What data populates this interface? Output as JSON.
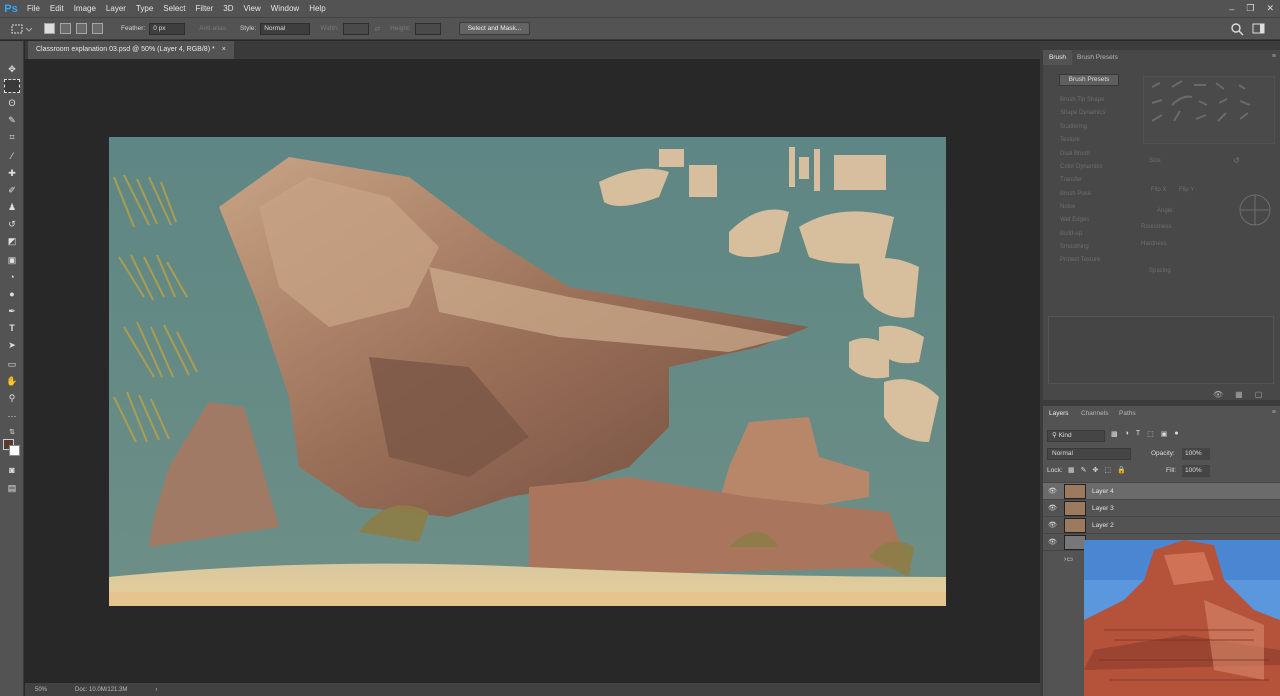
{
  "app": {
    "logo": "Ps",
    "accent": "#31a8ff"
  },
  "menu": [
    "File",
    "Edit",
    "Image",
    "Layer",
    "Type",
    "Select",
    "Filter",
    "3D",
    "View",
    "Window",
    "Help"
  ],
  "window_controls": {
    "minimize": "–",
    "restore": "❐",
    "close": "✕"
  },
  "options_bar": {
    "feather_label": "Feather:",
    "feather_value": "0 px",
    "anti_alias_label": "Anti-alias",
    "style_label": "Style:",
    "style_value": "Normal",
    "width_label": "Width:",
    "height_label": "Height:",
    "select_mask_button": "Select and Mask..."
  },
  "document": {
    "tab_title": "Classroom explanation 03.psd @ 50% (Layer 4, RGB/8) *",
    "close": "×"
  },
  "status": {
    "zoom": "50%",
    "doc": "Doc: 10.0M/121.3M",
    "arrow": "›"
  },
  "brush_panel": {
    "tabs": [
      "Brush",
      "Brush Presets"
    ],
    "presets_button": "Brush Presets",
    "options": [
      "Brush Tip Shape",
      "Shape Dynamics",
      "Scattering",
      "Texture",
      "Dual Brush",
      "Color Dynamics",
      "Transfer",
      "Brush Pose",
      "Noise",
      "Wet Edges",
      "Build-up",
      "Smoothing",
      "Protect Texture"
    ],
    "size_label": "Size",
    "flip_x": "Flip X",
    "flip_y": "Flip Y",
    "angle_label": "Angle:",
    "roundness_label": "Roundness:",
    "hardness_label": "Hardness",
    "spacing_label": "Spacing"
  },
  "layers_panel": {
    "tabs": [
      "Layers",
      "Channels",
      "Paths"
    ],
    "filter_label": "Kind",
    "blend_mode": "Normal",
    "opacity_label": "Opacity:",
    "opacity_value": "100%",
    "lock_label": "Lock:",
    "fill_label": "Fill:",
    "fill_value": "100%",
    "layers": [
      {
        "name": "Layer 4",
        "selected": true
      },
      {
        "name": "Layer 3",
        "selected": false
      },
      {
        "name": "Layer 2",
        "selected": false
      }
    ]
  }
}
